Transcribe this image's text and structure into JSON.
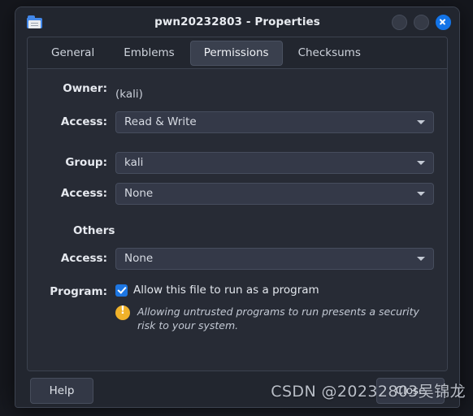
{
  "window": {
    "title": "pwn20232803 - Properties",
    "icon": "folder-icon",
    "controls": {
      "minimize_label": "",
      "maximize_label": "",
      "close_label": "×"
    }
  },
  "tabs": [
    {
      "label": "General",
      "active": false
    },
    {
      "label": "Emblems",
      "active": false
    },
    {
      "label": "Permissions",
      "active": true
    },
    {
      "label": "Checksums",
      "active": false
    }
  ],
  "permissions": {
    "owner": {
      "label": "Owner:",
      "value": "(kali)",
      "access_label": "Access:",
      "access_value": "Read & Write"
    },
    "group": {
      "label": "Group:",
      "value": "kali",
      "access_label": "Access:",
      "access_value": "None"
    },
    "others": {
      "label": "Others",
      "access_label": "Access:",
      "access_value": "None"
    },
    "program": {
      "label": "Program:",
      "checkbox_label": "Allow this file to run as a program",
      "checked": true,
      "warning": "Allowing untrusted programs to run presents a security risk to your system."
    }
  },
  "actions": {
    "help_label": "Help",
    "close_label": "Close"
  },
  "watermark": "CSDN @20232803吴锦龙",
  "colors": {
    "accent": "#1374e8",
    "checkbox": "#1d76e2",
    "warning": "#f0b22a",
    "window_bg": "#22262f",
    "panel_bg": "#272b35",
    "field_bg": "#343948"
  }
}
